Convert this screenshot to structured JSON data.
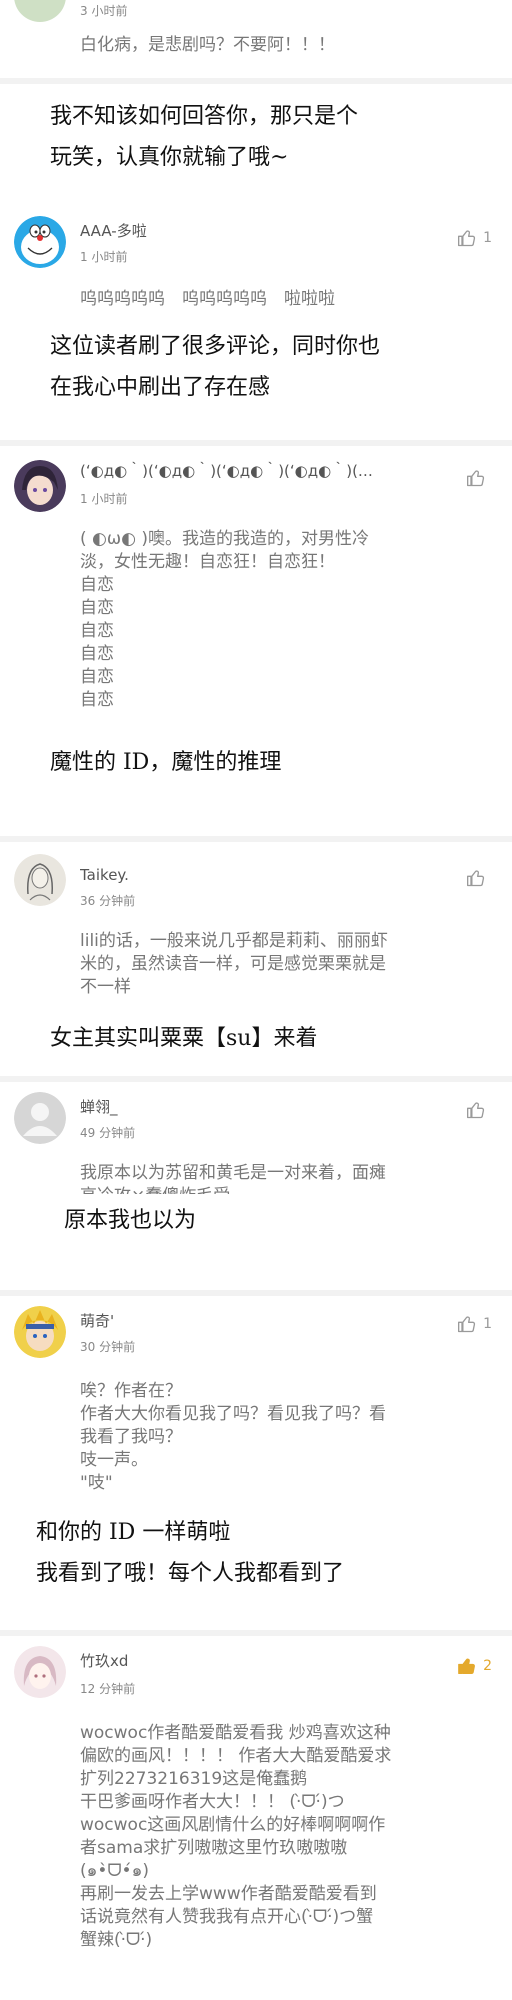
{
  "top": {
    "time": "3 小时前",
    "text": "白化病，是悲剧吗？不要阿！！！"
  },
  "replies": [
    "我不知该如何回答你，那只是个\n玩笑，认真你就输了哦~",
    "这位读者刷了很多评论，同时你也\n在我心中刷出了存在感",
    "魔性的 ID，魔性的推理",
    "女主其实叫粟粟【su】来着",
    "原本我也以为",
    "和你的 ID 一样萌啦\n我看到了哦！每个人我都看到了"
  ],
  "comments": [
    {
      "username": "AAA-多啦",
      "time": "1 小时前",
      "likes": "1",
      "avatar_icon": "doraemon-icon",
      "text": "呜呜呜呜呜　呜呜呜呜呜　啦啦啦"
    },
    {
      "username": "(ʻ◐д◐｀)(ʻ◐д◐｀)(ʻ◐д◐｀)(ʻ◐д◐｀)(…",
      "time": "1 小时前",
      "likes": "",
      "avatar_icon": "anime-girl-avatar-icon",
      "text": "( ◐ω◐ )噢。我造的我造的，对男性冷\n淡，女性无趣！自恋狂！自恋狂！\n自恋\n自恋\n自恋\n自恋\n自恋\n自恋"
    },
    {
      "username": "Taikey.",
      "time": "36 分钟前",
      "likes": "",
      "avatar_icon": "sketch-avatar-icon",
      "text": "lili的话，一般来说几乎都是莉莉、丽丽虾\n米的，虽然读音一样，可是感觉栗栗就是\n不一样"
    },
    {
      "username": "蝉翎_",
      "time": "49 分钟前",
      "likes": "",
      "avatar_icon": "default-user-avatar-icon",
      "text": "我原本以为苏留和黄毛是一对来着，面瘫\n高冷攻×蠢傻炸毛受"
    },
    {
      "username": "萌奇'",
      "time": "30 分钟前",
      "likes": "1",
      "avatar_icon": "naruto-avatar-icon",
      "text": "唉？作者在？\n作者大大你看见我了吗？看见我了吗？看\n我看了我吗？\n吱一声。\n\"吱\""
    },
    {
      "username": "竹玖xd",
      "time": "12 分钟前",
      "likes": "2",
      "avatar_icon": "girl-avatar-icon",
      "text": "wocwoc作者酷爱酷爱看我 炒鸡喜欢这种\n偏欧的画风！！！！ 作者大大酷爱酷爱求\n扩列2273216319这是俺蠢鹅\n干巴爹画呀作者大大！！！ (·̀ᗜ·́)つ\nwocwoc这画风剧情什么的好棒啊啊啊作\n者sama求扩列嗷嗷这里竹玖嗷嗷嗷\n(๑•̀ᗜ•́๑)\n再刷一发去上学www作者酷爱酷爱看到\n话说竟然有人赞我我有点开心(·̀ᗜ·́)つ蟹\n蟹辣(·̀ᗜ·́)"
    }
  ],
  "colors": {
    "like_active": "#e4a92c",
    "like_default": "#9a9a9a",
    "reply_text": "#111111",
    "comment_text": "#777777"
  }
}
